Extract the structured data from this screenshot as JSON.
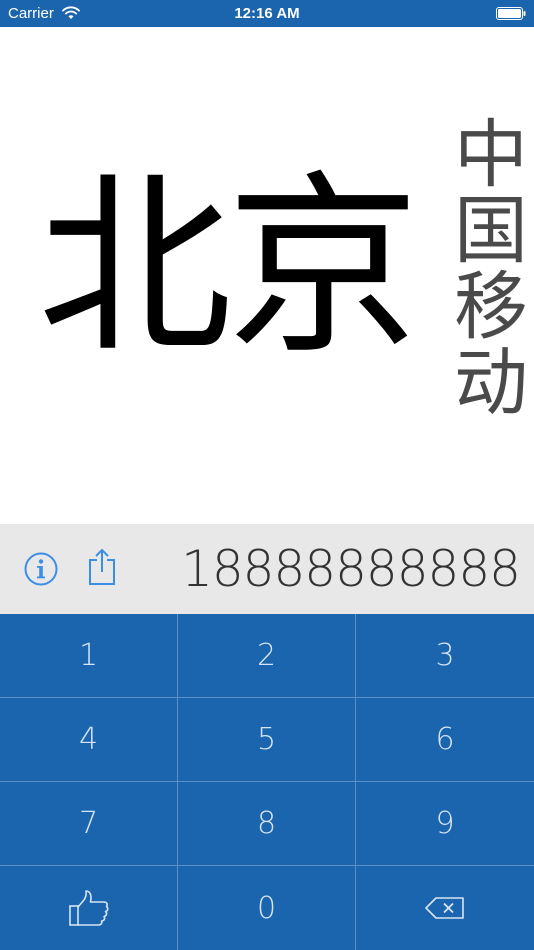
{
  "status_bar": {
    "carrier": "Carrier",
    "time": "12:16 AM"
  },
  "display": {
    "city": "北京",
    "operator": "中国移动"
  },
  "info_bar": {
    "phone_number": "18888888888"
  },
  "keypad": {
    "keys": [
      "1",
      "2",
      "3",
      "4",
      "5",
      "6",
      "7",
      "8",
      "9",
      "",
      "0",
      ""
    ]
  },
  "colors": {
    "primary": "#1a65ad",
    "key_text": "#d6e4f3",
    "info_bar_bg": "#e8e8e8",
    "icon_blue": "#3a8ee6"
  },
  "icons": {
    "info": "info-circle-icon",
    "share": "share-icon",
    "like": "thumbs-up-icon",
    "delete": "backspace-icon"
  }
}
